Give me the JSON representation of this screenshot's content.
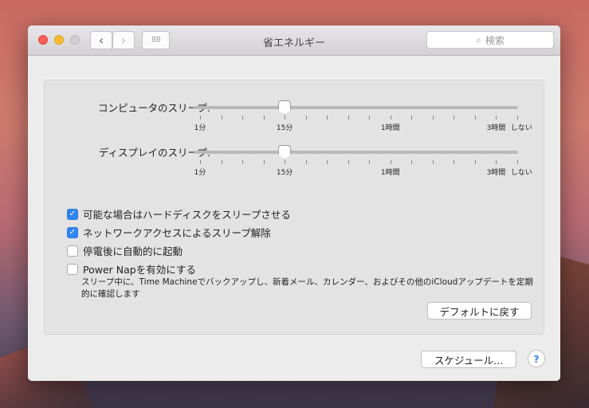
{
  "window": {
    "title": "省エネルギー",
    "search_placeholder": "検索"
  },
  "sliders": [
    {
      "label": "コンピュータのスリープ:",
      "value_index": 4,
      "tick_count": 16
    },
    {
      "label": "ディスプレイのスリープ:",
      "value_index": 4,
      "tick_count": 16
    }
  ],
  "tick_labels": [
    {
      "text": "1分",
      "tick": 0
    },
    {
      "text": "15分",
      "tick": 4
    },
    {
      "text": "1時間",
      "tick": 9
    },
    {
      "text": "3時間",
      "tick": 14
    },
    {
      "text": "しない",
      "tick": 15.2
    }
  ],
  "checkboxes": [
    {
      "label": "可能な場合はハードディスクをスリープさせる",
      "checked": true
    },
    {
      "label": "ネットワークアクセスによるスリープ解除",
      "checked": true
    },
    {
      "label": "停電後に自動的に起動",
      "checked": false
    },
    {
      "label": "Power Napを有効にする",
      "checked": false
    }
  ],
  "power_nap_desc": "スリープ中に、Time Machineでバックアップし、新着メール、カレンダー、およびその他のiCloudアップデートを定期的に確認します",
  "buttons": {
    "restore_defaults": "デフォルトに戻す",
    "schedule": "スケジュール...",
    "help": "?"
  }
}
